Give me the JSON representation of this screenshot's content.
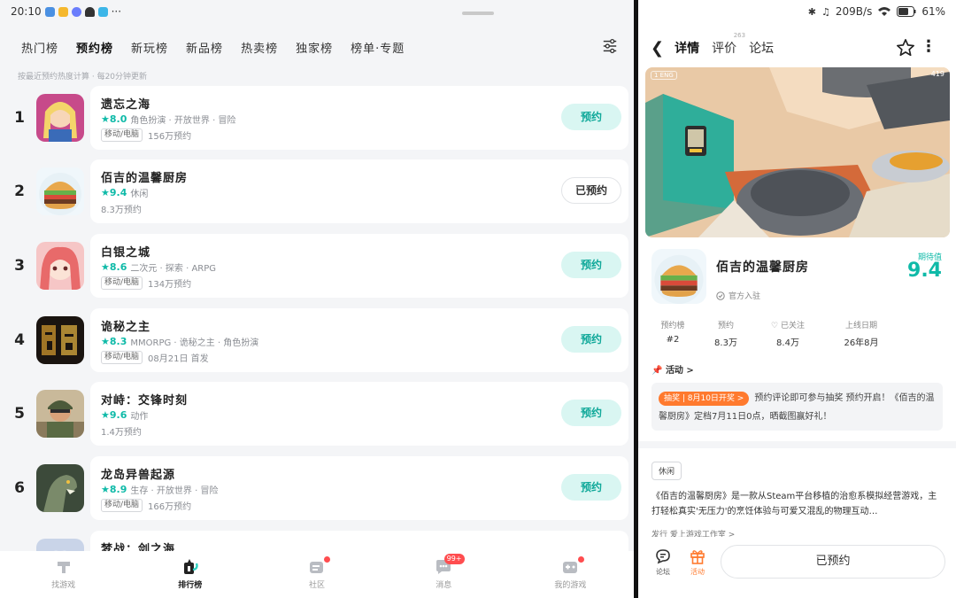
{
  "left": {
    "status": {
      "time": "20:10",
      "more": "···"
    },
    "tabs": [
      "热门榜",
      "预约榜",
      "新玩榜",
      "新品榜",
      "热卖榜",
      "独家榜",
      "榜单·专题"
    ],
    "active_tab": "预约榜",
    "note": "按最近预约热度计算 · 每20分钟更新",
    "games": [
      {
        "rank": "1",
        "name": "遗忘之海",
        "score": "8.0",
        "tags": "角色扮演 · 开放世界 · 冒险",
        "platform": "移动/电脑",
        "info": "156万预约",
        "button": "预约",
        "reserved": false
      },
      {
        "rank": "2",
        "name": "佰吉的温馨厨房",
        "score": "9.4",
        "tags": "休闲",
        "platform": "",
        "info": "8.3万预约",
        "button": "已预约",
        "reserved": true
      },
      {
        "rank": "3",
        "name": "白银之城",
        "score": "8.6",
        "tags": "二次元 · 探索 · ARPG",
        "platform": "移动/电脑",
        "info": "134万预约",
        "button": "预约",
        "reserved": false
      },
      {
        "rank": "4",
        "name": "诡秘之主",
        "score": "8.3",
        "tags": "MMORPG · 诡秘之主 · 角色扮演",
        "platform": "移动/电脑",
        "info": "08月21日 首发",
        "button": "预约",
        "reserved": false
      },
      {
        "rank": "5",
        "name": "对峙：交锋时刻",
        "score": "9.6",
        "tags": "动作",
        "platform": "",
        "info": "1.4万预约",
        "button": "预约",
        "reserved": false
      },
      {
        "rank": "6",
        "name": "龙岛异兽起源",
        "score": "8.9",
        "tags": "生存 · 开放世界 · 冒险",
        "platform": "移动/电脑",
        "info": "166万预约",
        "button": "预约",
        "reserved": false
      },
      {
        "rank": "7",
        "name": "梦战：剑之海",
        "score": "",
        "tags": "",
        "platform": "",
        "info": "",
        "button": "",
        "reserved": false
      }
    ],
    "nav": [
      {
        "label": "找游戏",
        "icon": "game-bag-icon"
      },
      {
        "label": "排行榜",
        "icon": "ranking-icon"
      },
      {
        "label": "社区",
        "icon": "community-icon"
      },
      {
        "label": "消息",
        "icon": "message-icon",
        "badge": "99+"
      },
      {
        "label": "我的游戏",
        "icon": "my-games-icon"
      }
    ]
  },
  "right": {
    "status": {
      "speed": "209B/s",
      "battery": "61%"
    },
    "tabs": {
      "detail": "详情",
      "reviews": "评价",
      "reviews_count": "263",
      "forum": "论坛"
    },
    "hero": {
      "tag": "1 ENG",
      "count": "419"
    },
    "game": {
      "name": "佰吉的温馨厨房",
      "official": "官方入驻",
      "score_label": "期待值",
      "score": "9.4"
    },
    "stats": [
      {
        "label": "预约榜",
        "value": "#2"
      },
      {
        "label": "预约",
        "value": "8.3万"
      },
      {
        "label": "♡ 已关注",
        "value": "8.4万"
      },
      {
        "label": "上线日期",
        "value": "26年8月"
      }
    ],
    "activity": {
      "title": "活动 >",
      "badge": "抽奖 | 8月10日开奖 >",
      "text": "预约评论即可参与抽奖 预约开启！《佰吉的温馨厨房》定档7月11日0点，晒截图赢好礼！"
    },
    "tag": "休闲",
    "description": "《佰吉的温馨厨房》是一款从Steam平台移植的治愈系模拟经营游戏，主打轻松真实'无压力'的烹饪体验与可爱又混乱的物理互动…",
    "more_line": "发行  爱上游戏工作室 >",
    "bottom": {
      "forum_label": "论坛",
      "activity_label": "活动",
      "reserve_button": "已预约"
    }
  },
  "colors": {
    "accent": "#0fbaa8",
    "accent_light": "#d9f6f2",
    "orange": "#ff7a2e",
    "badge_red": "#ff4d4f"
  }
}
